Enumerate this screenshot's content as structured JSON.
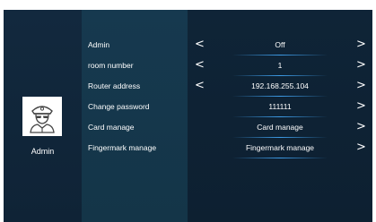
{
  "profile": {
    "name": "Admin",
    "icon": "security-guard-avatar-icon"
  },
  "settings": [
    {
      "label": "Admin",
      "value": "Off",
      "left_arrow": "<",
      "right_arrow": ">"
    },
    {
      "label": "room number",
      "value": "1",
      "left_arrow": "<",
      "right_arrow": ">"
    },
    {
      "label": "Router address",
      "value": "192.168.255.104",
      "left_arrow": "<",
      "right_arrow": ">"
    },
    {
      "label": "Change password",
      "value": "111111",
      "left_arrow": "",
      "right_arrow": ">"
    },
    {
      "label": "Card manage",
      "value": "Card manage",
      "left_arrow": "",
      "right_arrow": ">"
    },
    {
      "label": "Fingermark manage",
      "value": "Fingermark manage",
      "left_arrow": "",
      "right_arrow": ">"
    }
  ],
  "colors": {
    "background": "#0e2335",
    "labels_panel": "#16394f",
    "accent_line": "#3d9be6",
    "text": "#ffffff"
  }
}
